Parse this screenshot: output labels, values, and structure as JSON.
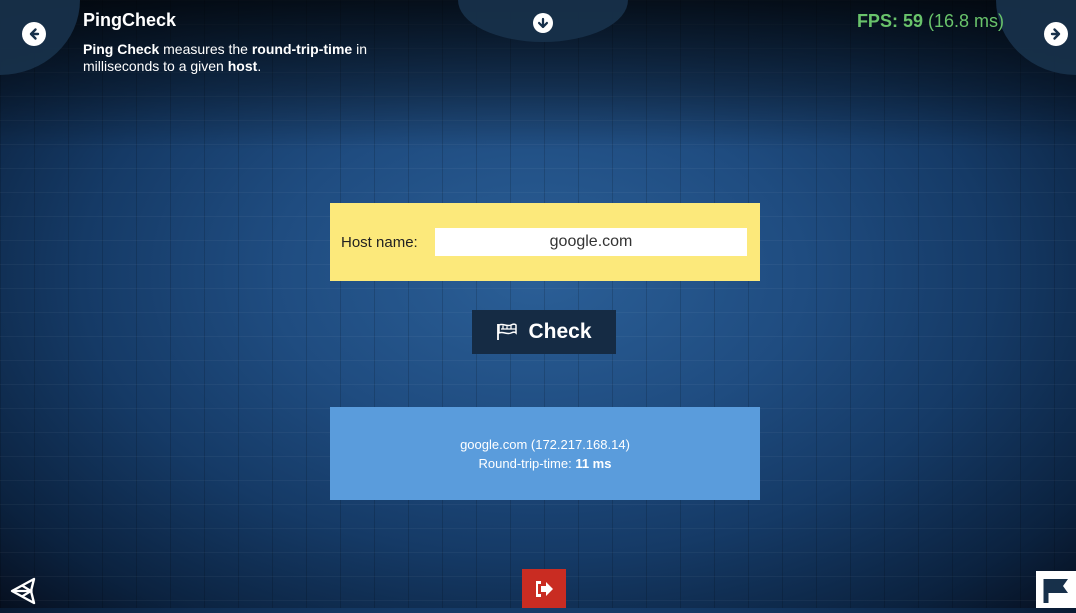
{
  "header": {
    "title": "PingCheck",
    "description": {
      "part1": "Ping Check",
      "part2": " measures the ",
      "part3": "round-trip-time",
      "part4": " in milliseconds to a given ",
      "part5": "host",
      "part6": "."
    },
    "fps_label": "FPS: 59",
    "fps_ms": " (16.8 ms)"
  },
  "form": {
    "host_label": "Host name:",
    "host_value": "google.com"
  },
  "check_button": {
    "label": "Check"
  },
  "result": {
    "line1": "google.com (172.217.168.14)",
    "rtt_label": "Round-trip-time: ",
    "rtt_value": "11 ms"
  },
  "icons": {
    "back": "arrow-left-circle-icon",
    "forward": "arrow-right-circle-icon",
    "down": "arrow-down-circle-icon",
    "unity": "unity-logo-icon",
    "exit": "exit-icon",
    "flag": "flag-icon"
  },
  "colors": {
    "host_panel": "#fce97b",
    "result_panel": "#5a9cdc",
    "check_button": "#152b44",
    "fps": "#69c36b",
    "exit": "#c92c22"
  }
}
